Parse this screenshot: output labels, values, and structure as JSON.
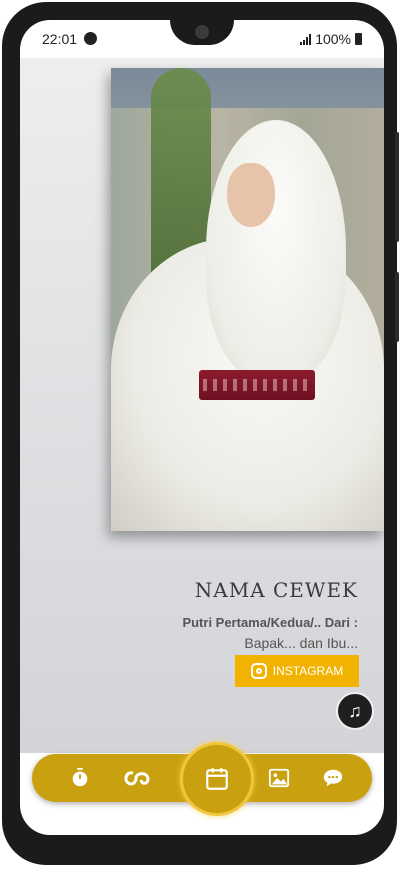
{
  "status_bar": {
    "time": "22:01",
    "battery": "100%"
  },
  "profile": {
    "name": "NAMA CEWEK",
    "child_of": "Putri Pertama/Kedua/.. Dari :",
    "parents": "Bapak... dan Ibu...",
    "instagram_label": "INSTAGRAM"
  },
  "nav": {
    "items": [
      {
        "icon": "stopwatch-icon"
      },
      {
        "icon": "couple-icon"
      },
      {
        "icon": "calendar-icon"
      },
      {
        "icon": "gallery-icon"
      },
      {
        "icon": "chat-icon"
      }
    ]
  },
  "colors": {
    "accent": "#c9a00f",
    "instagram_button": "#f1b300"
  }
}
